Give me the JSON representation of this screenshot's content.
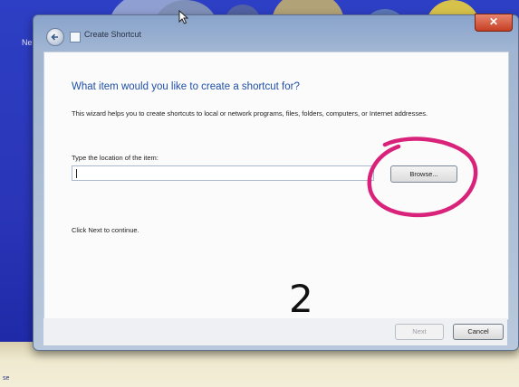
{
  "window": {
    "title": "Create Shortcut",
    "close_glyph": "✕"
  },
  "desktop": {
    "left_label": "Ne",
    "bottom_label": "se"
  },
  "wizard": {
    "heading": "What item would you like to create a shortcut for?",
    "description": "This wizard helps you to create shortcuts to local or network programs, files, folders, computers, or Internet addresses.",
    "location_label": "Type the location of the item:",
    "location_value": "",
    "browse_label": "Browse...",
    "continue_text": "Click Next to continue."
  },
  "buttons": {
    "next_label": "Next",
    "cancel_label": "Cancel"
  },
  "annotation": {
    "step_number": "2",
    "circle_color": "#d9237a"
  },
  "icons": {
    "back": "back-arrow-icon",
    "title": "shortcut-icon",
    "cursor": "mouse-cursor-icon"
  }
}
